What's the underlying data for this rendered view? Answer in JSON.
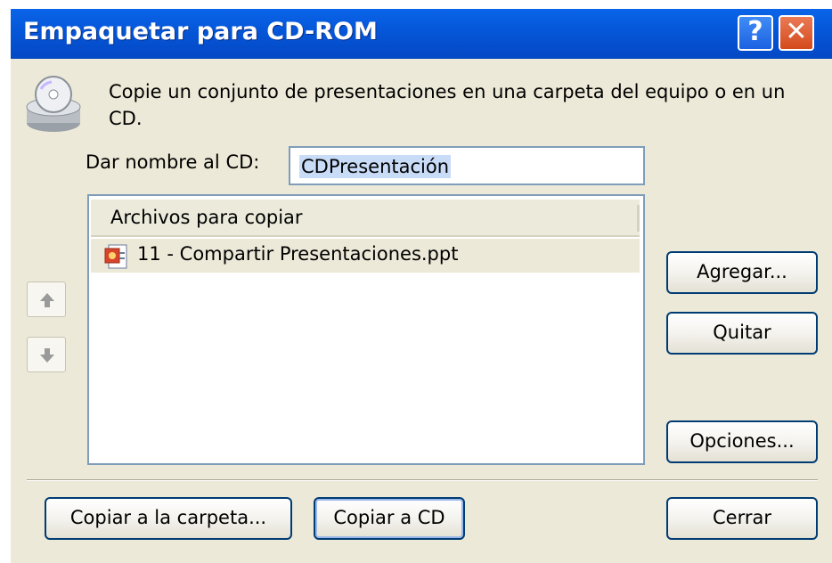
{
  "window": {
    "title": "Empaquetar para CD-ROM",
    "help_glyph": "?",
    "close_glyph": "✕"
  },
  "description": "Copie un conjunto de presentaciones en una carpeta del equipo o en un CD.",
  "cd_name": {
    "label": "Dar nombre al CD:",
    "value": "CDPresentación"
  },
  "files": {
    "header": "Archivos para copiar",
    "items": [
      {
        "name": "11 - Compartir Presentaciones.ppt",
        "icon": "powerpoint-file-icon"
      }
    ]
  },
  "buttons": {
    "agregar": "Agregar...",
    "quitar": "Quitar",
    "opciones": "Opciones...",
    "copiar_carpeta": "Copiar a la carpeta...",
    "copiar_cd": "Copiar a CD",
    "cerrar": "Cerrar"
  },
  "icons": {
    "cd": "cd-drive-icon",
    "up": "move-up-icon",
    "down": "move-down-icon"
  },
  "colors": {
    "titlebar": "#0556d8",
    "dialog_bg": "#ece9d8",
    "button_border": "#003c74",
    "close_button": "#d44a1d"
  }
}
